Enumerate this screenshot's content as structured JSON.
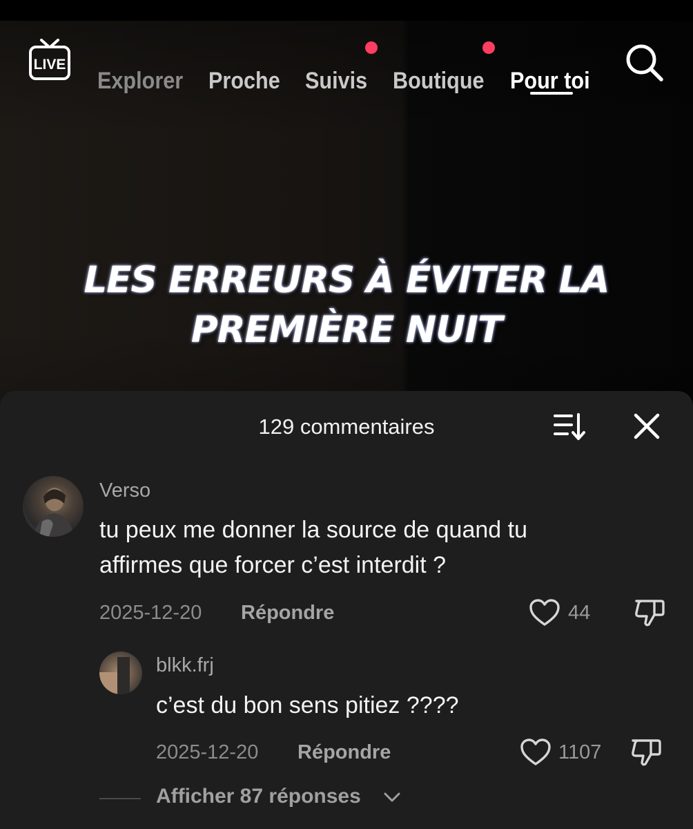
{
  "nav": {
    "live_label": "LIVE",
    "tabs": [
      {
        "label": "Explorer",
        "state": "dim"
      },
      {
        "label": "Proche",
        "state": "normal"
      },
      {
        "label": "Suivis",
        "state": "normal",
        "notification_dot": true
      },
      {
        "label": "Boutique",
        "state": "normal",
        "notification_dot": true
      },
      {
        "label": "Pour toi",
        "state": "active"
      }
    ],
    "search_icon": "search-icon"
  },
  "video": {
    "caption_line1": "LES ERREURS À ÉVITER LA",
    "caption_line2": "PREMIÈRE NUIT"
  },
  "comments_panel": {
    "title": "129 commentaires",
    "sort_icon": "sort-icon",
    "close_icon": "close-icon",
    "comments": [
      {
        "username": "Verso",
        "text_line1": "tu peux me donner la source de quand tu",
        "text_line2": "affirmes que forcer c’est interdit ?",
        "date": "2025-12-20",
        "reply_label": "Répondre",
        "likes": "44"
      }
    ],
    "replies": [
      {
        "username": "blkk.frj",
        "text": "c’est du bon sens pitiez ????",
        "date": "2025-12-20",
        "reply_label": "Répondre",
        "likes": "1107"
      }
    ],
    "show_more_replies": "Afficher 87 réponses"
  },
  "colors": {
    "accent_dot": "#fe3d63",
    "panel_bg": "#1e1e1e",
    "active_tab": "#ffffff"
  }
}
